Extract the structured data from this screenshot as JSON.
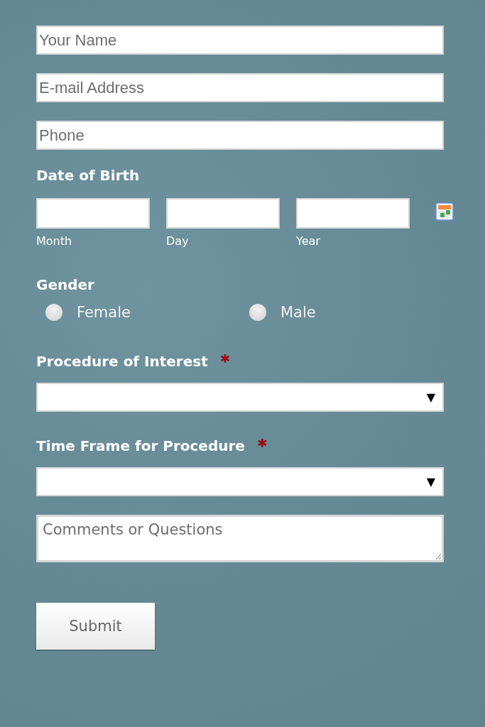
{
  "contact_fields": [
    {
      "placeholder": "Your Name"
    },
    {
      "placeholder": "E-mail Address"
    },
    {
      "placeholder": "Phone"
    }
  ],
  "date_of_birth": {
    "label": "Date of Birth",
    "parts": [
      {
        "caption": "Month"
      },
      {
        "caption": "Day"
      },
      {
        "caption": "Year"
      }
    ]
  },
  "gender": {
    "label": "Gender",
    "options": [
      {
        "label": "Female",
        "selected": false
      },
      {
        "label": "Male",
        "selected": false
      }
    ]
  },
  "selects": [
    {
      "label": "Procedure of Interest",
      "required_mark": "*",
      "arrow": "▼"
    },
    {
      "label": "Time Frame for Procedure",
      "required_mark": "*",
      "arrow": "▼"
    }
  ],
  "comments": {
    "placeholder": "Comments or Questions"
  },
  "submit": {
    "label": "Submit"
  }
}
